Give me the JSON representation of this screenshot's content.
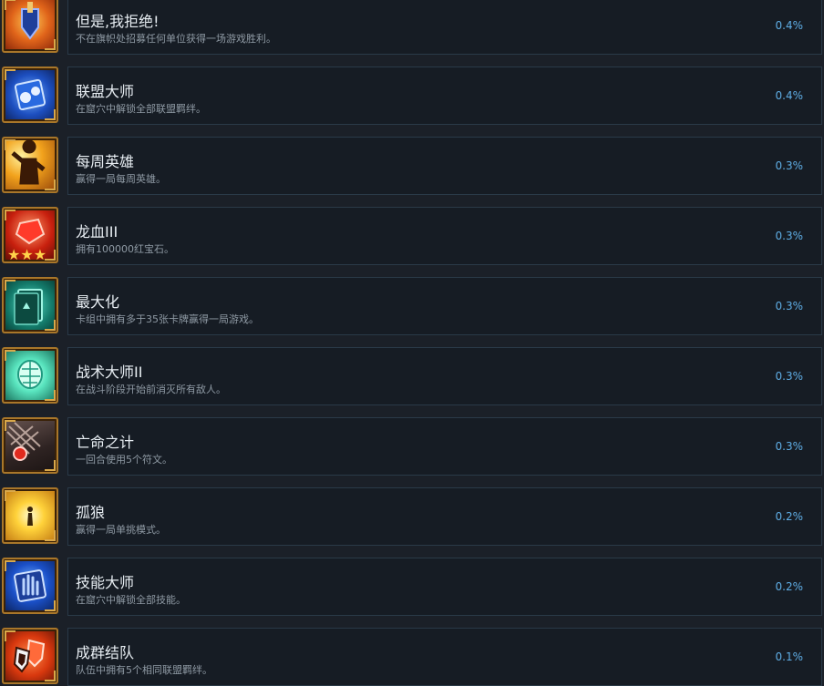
{
  "achievements": [
    {
      "title": "但是,我拒绝!",
      "desc": "不在旗帜处招募任何单位获得一场游戏胜利。",
      "pct": "0.4%",
      "icon": "banner-shield-icon"
    },
    {
      "title": "联盟大师",
      "desc": "在窟穴中解锁全部联盟羁绊。",
      "pct": "0.4%",
      "icon": "alliance-gears-icon"
    },
    {
      "title": "每周英雄",
      "desc": "赢得一局每周英雄。",
      "pct": "0.3%",
      "icon": "hero-silhouette-icon"
    },
    {
      "title": "龙血III",
      "desc": "拥有100000红宝石。",
      "pct": "0.3%",
      "icon": "ruby-stars-icon"
    },
    {
      "title": "最大化",
      "desc": "卡组中拥有多于35张卡牌赢得一局游戏。",
      "pct": "0.3%",
      "icon": "card-deck-icon"
    },
    {
      "title": "战术大师II",
      "desc": "在战斗阶段开始前消灭所有敌人。",
      "pct": "0.3%",
      "icon": "glowing-brain-icon"
    },
    {
      "title": "亡命之计",
      "desc": "一回合使用5个符文。",
      "pct": "0.3%",
      "icon": "rune-grid-icon"
    },
    {
      "title": "孤狼",
      "desc": "赢得一局单挑模式。",
      "pct": "0.2%",
      "icon": "lone-figure-icon"
    },
    {
      "title": "技能大师",
      "desc": "在窟穴中解锁全部技能。",
      "pct": "0.2%",
      "icon": "glowing-hand-icon"
    },
    {
      "title": "成群结队",
      "desc": "队伍中拥有5个相同联盟羁绊。",
      "pct": "0.1%",
      "icon": "shields-group-icon"
    }
  ]
}
